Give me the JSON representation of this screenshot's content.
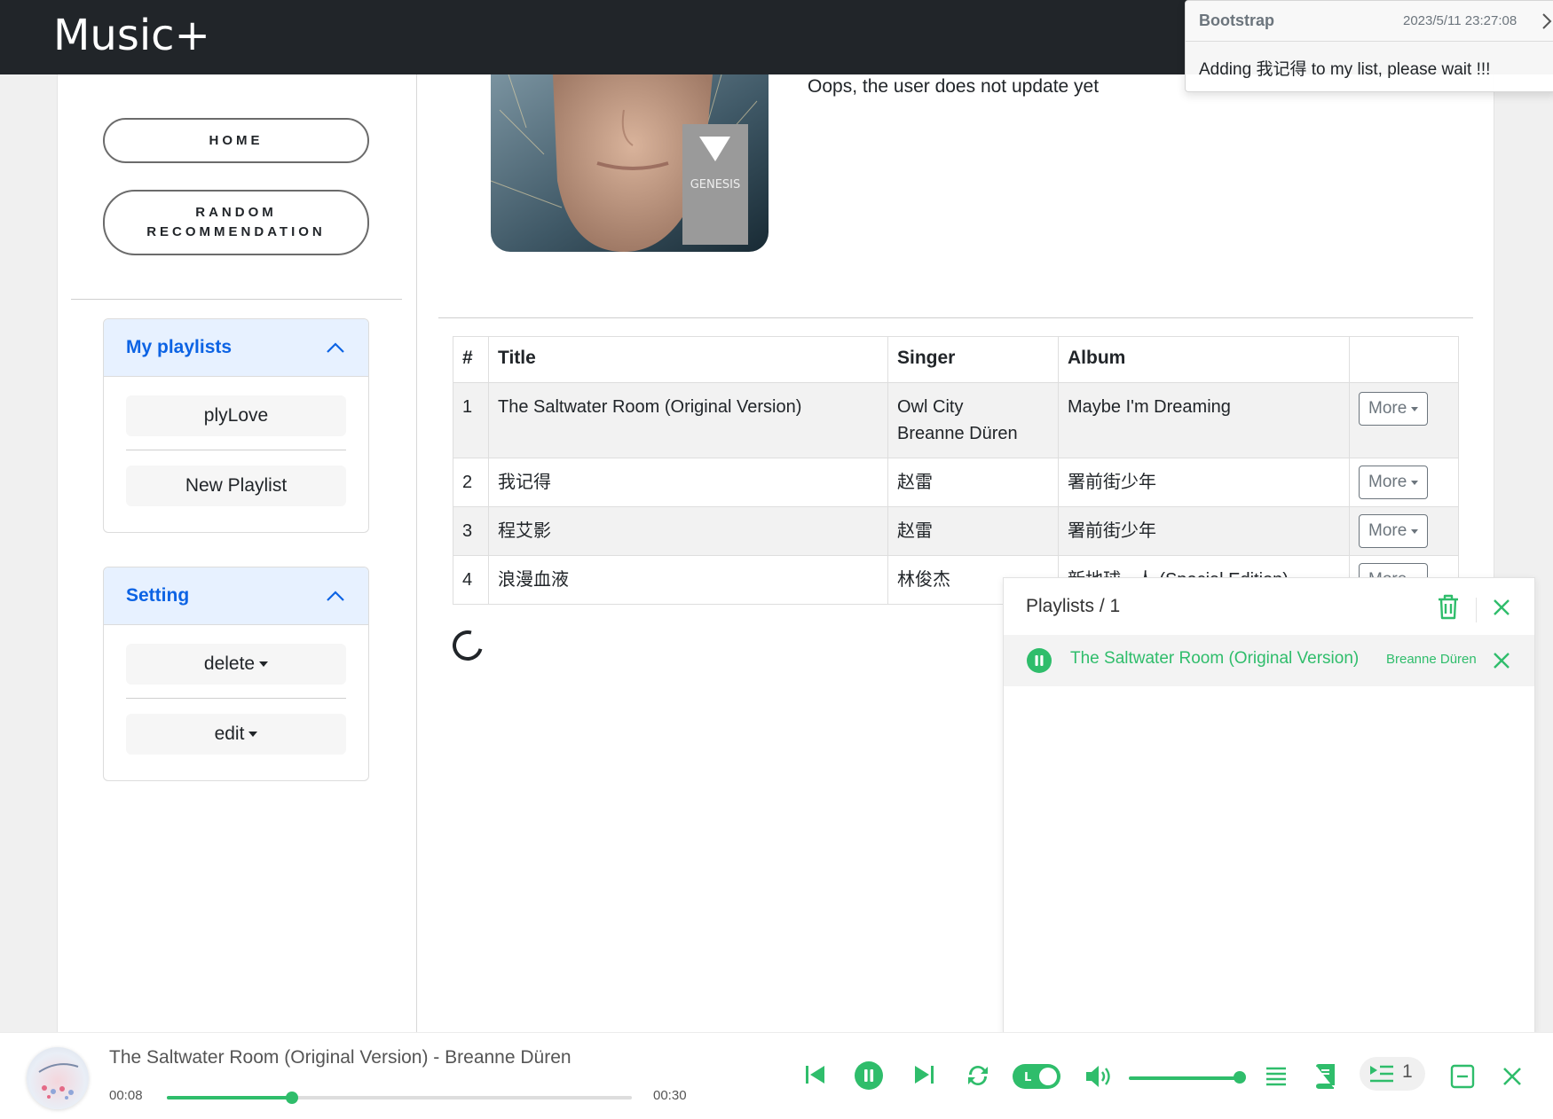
{
  "app": {
    "brand": "Music+"
  },
  "sidebar": {
    "home": "HOME",
    "random_line1": "RANDOM",
    "random_line2": "RECOMMENDATION",
    "playlists": {
      "title": "My playlists",
      "items": [
        "plyLove",
        "New Playlist"
      ]
    },
    "setting": {
      "title": "Setting",
      "items": [
        "delete",
        "edit"
      ]
    }
  },
  "main": {
    "no_update_text": "Oops, the user does not update yet",
    "cover_text": "GENESIS",
    "table": {
      "headers": [
        "#",
        "Title",
        "Singer",
        "Album",
        ""
      ],
      "rows": [
        {
          "num": "1",
          "title": "The Saltwater Room (Original Version)",
          "singer_line1": "Owl City",
          "singer_line2": "Breanne Düren",
          "album": "Maybe I'm Dreaming",
          "action": "More"
        },
        {
          "num": "2",
          "title": "我记得",
          "singer_line1": "赵雷",
          "singer_line2": "",
          "album": "署前街少年",
          "action": "More"
        },
        {
          "num": "3",
          "title": "程艾影",
          "singer_line1": "赵雷",
          "singer_line2": "",
          "album": "署前街少年",
          "action": "More"
        },
        {
          "num": "4",
          "title": "浪漫血液",
          "singer_line1": "林俊杰",
          "singer_line2": "",
          "album": "新地球 - 人 (Special Edition)",
          "action": "More"
        }
      ]
    }
  },
  "toast": {
    "title": "Bootstrap",
    "time": "2023/5/11 23:27:08",
    "message": "Adding 我记得 to my list, please wait !!!"
  },
  "playlist_panel": {
    "header": "Playlists /  1",
    "current_song": "The Saltwater Room (Original Version)",
    "current_singer": "Breanne Düren"
  },
  "player": {
    "now_playing": "The Saltwater Room (Original Version) - Breanne Düren",
    "current_time": "00:08",
    "total_time": "00:30",
    "progress_fraction": 0.27,
    "volume_fraction": 1.0,
    "lyric_toggle_label": "L",
    "queue_count": "1",
    "accent_color": "#2fbd6b"
  }
}
